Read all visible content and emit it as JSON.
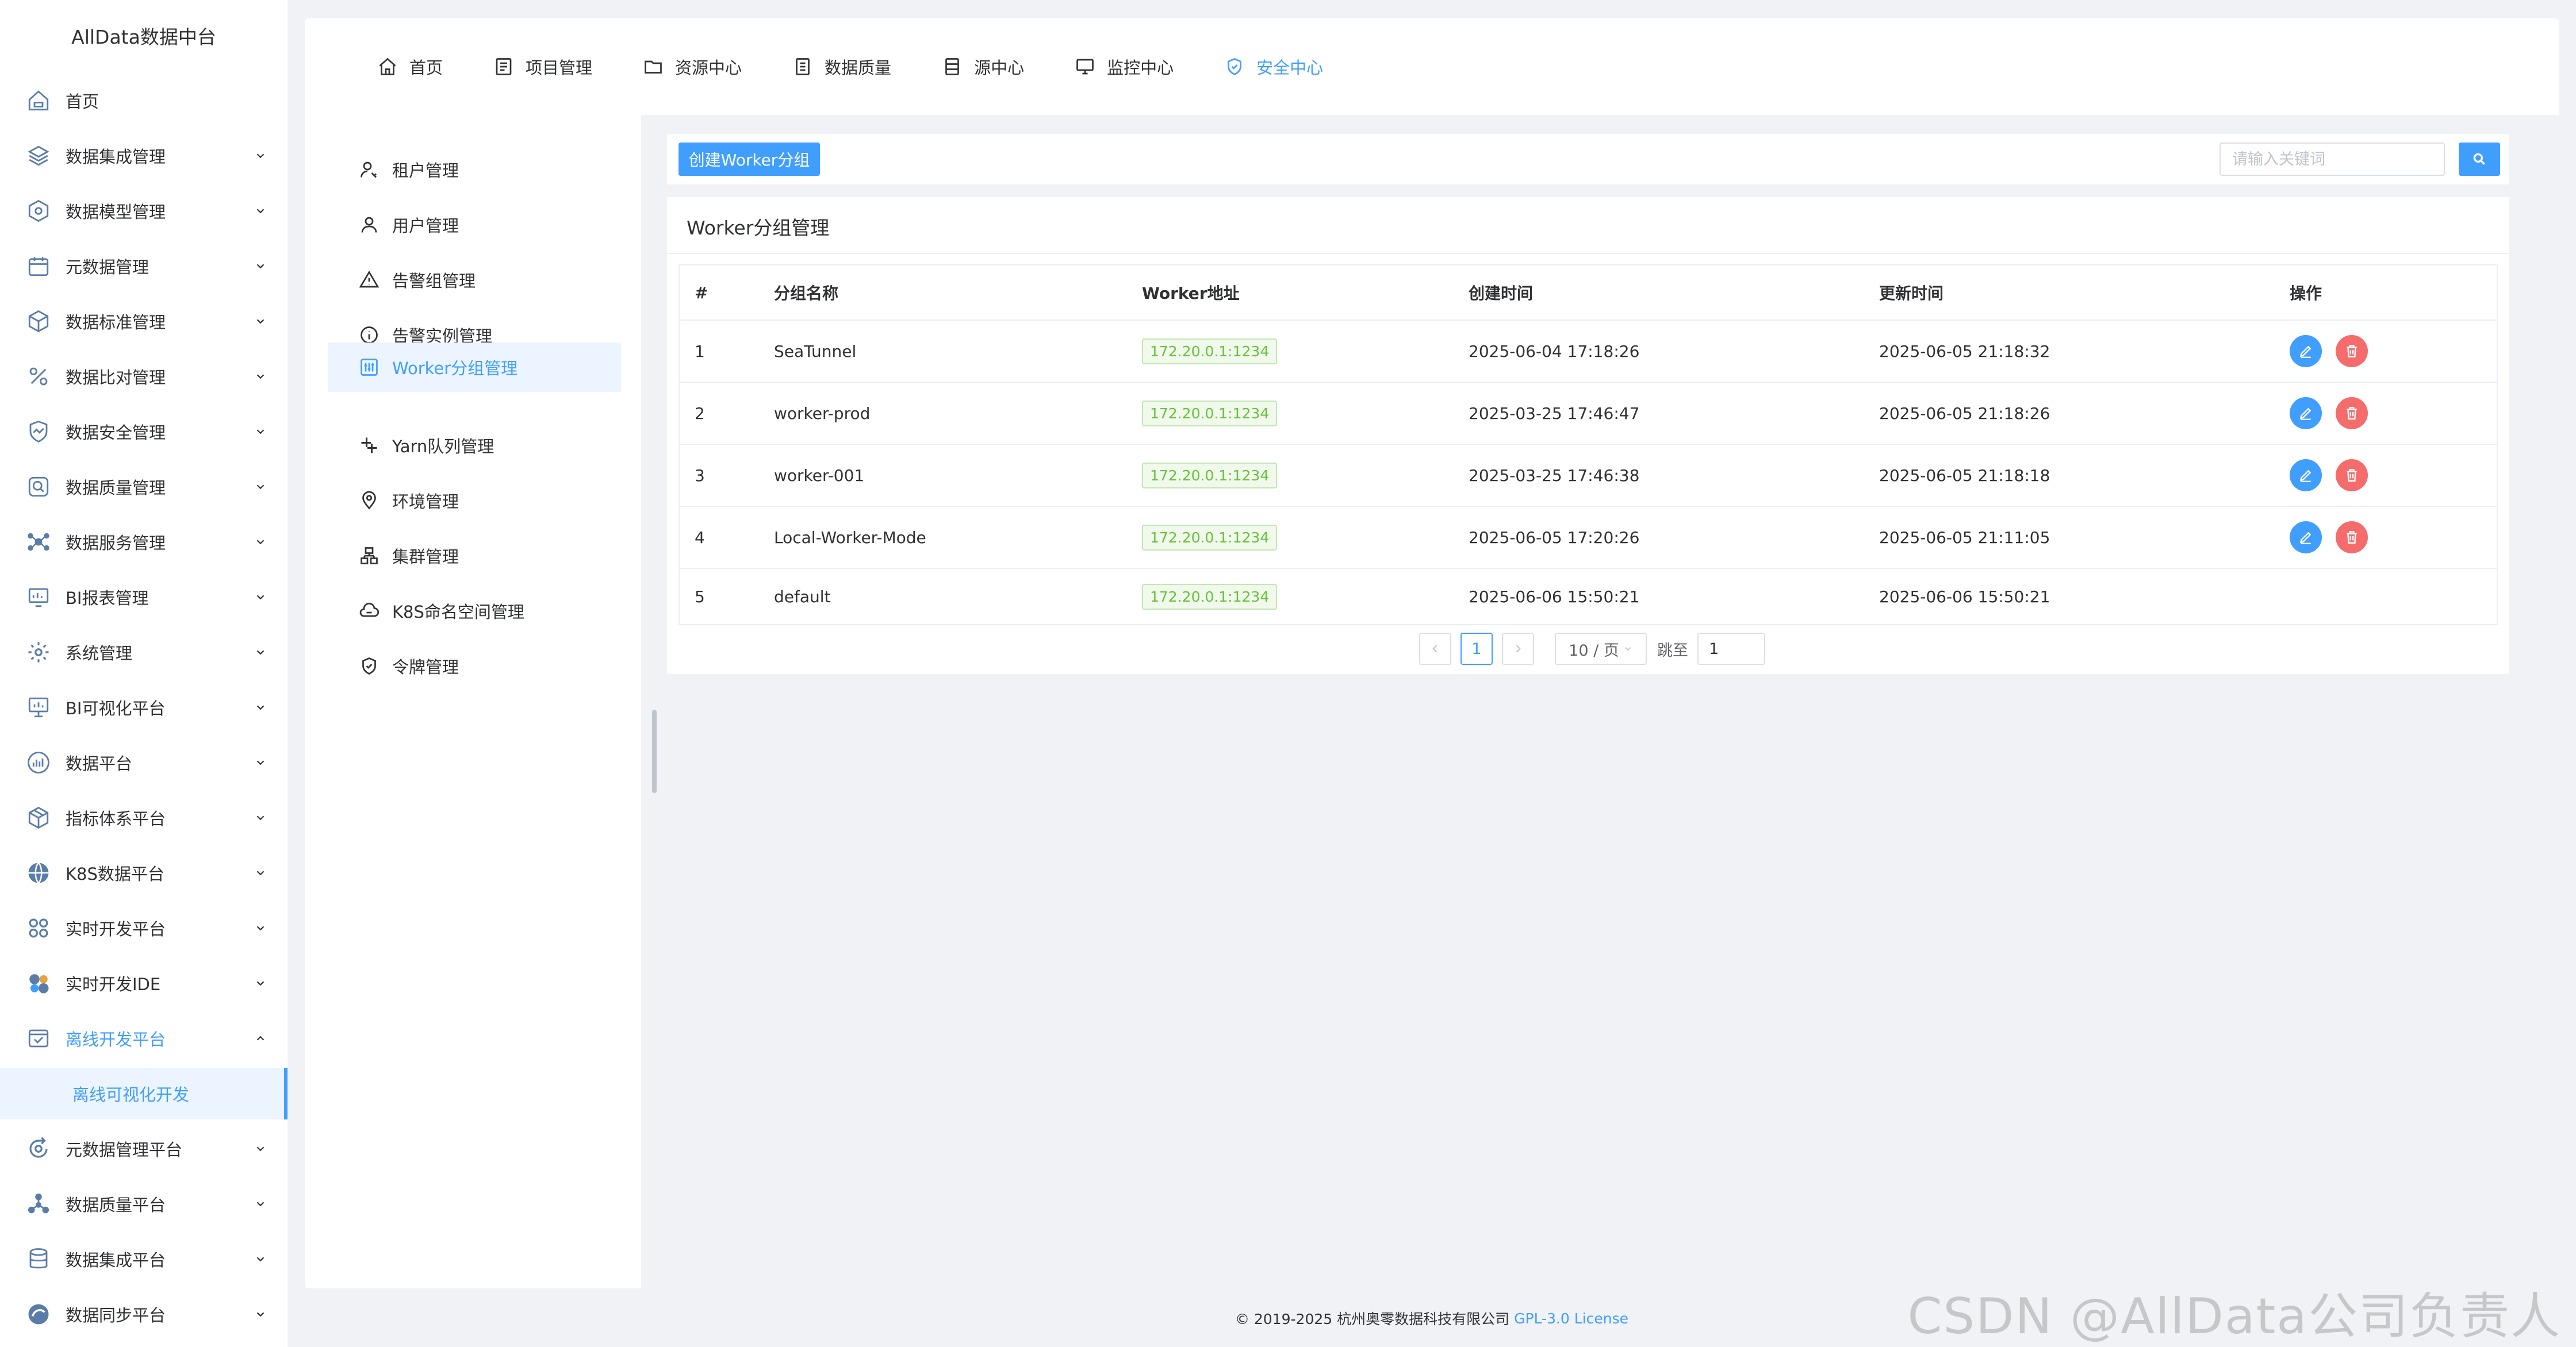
{
  "brand": "AllData数据中台",
  "sidebar": {
    "items": [
      {
        "label": "首页",
        "icon": "home-icon"
      },
      {
        "label": "数据集成管理",
        "icon": "layers-icon"
      },
      {
        "label": "数据模型管理",
        "icon": "hexagon-icon"
      },
      {
        "label": "元数据管理",
        "icon": "calendar-icon"
      },
      {
        "label": "数据标准管理",
        "icon": "cube-icon"
      },
      {
        "label": "数据比对管理",
        "icon": "percent-icon"
      },
      {
        "label": "数据安全管理",
        "icon": "shield-icon"
      },
      {
        "label": "数据质量管理",
        "icon": "search-icon"
      },
      {
        "label": "数据服务管理",
        "icon": "network-icon"
      },
      {
        "label": "BI报表管理",
        "icon": "monitor-icon"
      },
      {
        "label": "系统管理",
        "icon": "gear-icon"
      },
      {
        "label": "BI可视化平台",
        "icon": "display-icon"
      },
      {
        "label": "数据平台",
        "icon": "chart-icon"
      },
      {
        "label": "指标体系平台",
        "icon": "box-icon"
      },
      {
        "label": "K8S数据平台",
        "icon": "globe-icon"
      },
      {
        "label": "实时开发平台",
        "icon": "grid-icon"
      },
      {
        "label": "实时开发IDE",
        "icon": "ide-icon"
      },
      {
        "label": "离线开发平台",
        "icon": "offline-icon"
      }
    ],
    "sub_item": "离线可视化开发",
    "items_after": [
      {
        "label": "元数据管理平台",
        "icon": "refresh-icon"
      },
      {
        "label": "数据质量平台",
        "icon": "molecule-icon"
      },
      {
        "label": "数据集成平台",
        "icon": "database-icon"
      },
      {
        "label": "数据同步平台",
        "icon": "sync-icon"
      }
    ]
  },
  "topnav": [
    {
      "label": "首页"
    },
    {
      "label": "项目管理"
    },
    {
      "label": "资源中心"
    },
    {
      "label": "数据质量"
    },
    {
      "label": "源中心"
    },
    {
      "label": "监控中心"
    },
    {
      "label": "安全中心"
    }
  ],
  "subnav": [
    {
      "label": "租户管理"
    },
    {
      "label": "用户管理"
    },
    {
      "label": "告警组管理"
    },
    {
      "label": "告警实例管理"
    },
    {
      "label": "Worker分组管理"
    },
    {
      "label": "Yarn队列管理"
    },
    {
      "label": "环境管理"
    },
    {
      "label": "集群管理"
    },
    {
      "label": "K8S命名空间管理"
    },
    {
      "label": "令牌管理"
    }
  ],
  "toolbar": {
    "create_label": "创建Worker分组",
    "search_placeholder": "请输入关键词"
  },
  "table": {
    "title": "Worker分组管理",
    "headers": [
      "#",
      "分组名称",
      "Worker地址",
      "创建时间",
      "更新时间",
      "操作"
    ],
    "rows": [
      {
        "idx": "1",
        "name": "SeaTunnel",
        "addr": "172.20.0.1:1234",
        "created": "2025-06-04 17:18:26",
        "updated": "2025-06-05 21:18:32"
      },
      {
        "idx": "2",
        "name": "worker-prod",
        "addr": "172.20.0.1:1234",
        "created": "2025-03-25 17:46:47",
        "updated": "2025-06-05 21:18:26"
      },
      {
        "idx": "3",
        "name": "worker-001",
        "addr": "172.20.0.1:1234",
        "created": "2025-03-25 17:46:38",
        "updated": "2025-06-05 21:18:18"
      },
      {
        "idx": "4",
        "name": "Local-Worker-Mode",
        "addr": "172.20.0.1:1234",
        "created": "2025-06-05 17:20:26",
        "updated": "2025-06-05 21:11:05"
      },
      {
        "idx": "5",
        "name": "default",
        "addr": "172.20.0.1:1234",
        "created": "2025-06-06 15:50:21",
        "updated": "2025-06-06 15:50:21"
      }
    ]
  },
  "pager": {
    "current": "1",
    "page_size": "10 / 页",
    "jump_label": "跳至",
    "jump_value": "1"
  },
  "footer": {
    "text": "© 2019-2025 杭州奥零数据科技有限公司",
    "link": "GPL-3.0 License"
  },
  "watermark": "CSDN @AllData公司负责人",
  "colors": {
    "accent": "#409eff",
    "danger": "#f56c6c",
    "success": "#67c23a"
  }
}
